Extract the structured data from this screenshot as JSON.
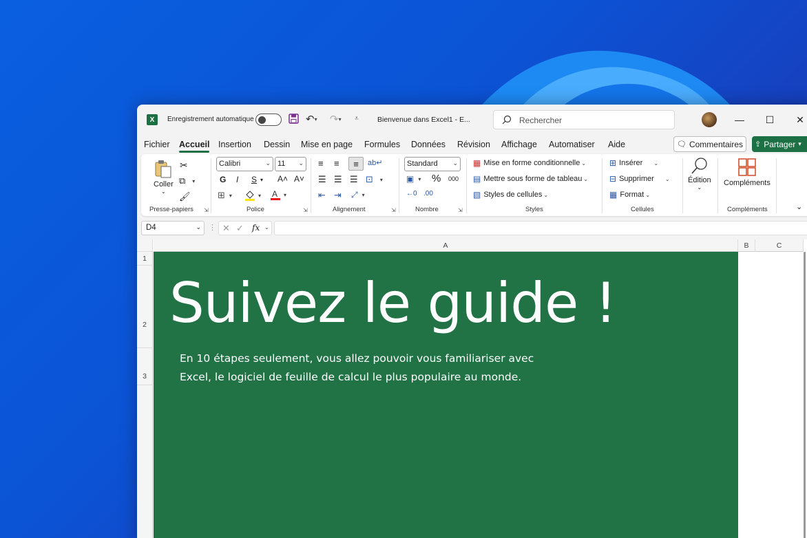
{
  "titlebar": {
    "app_icon": "X",
    "autosave_label": "Enregistrement automatique",
    "doc_title": "Bienvenue dans Excel1  -  E...",
    "search_placeholder": "Rechercher"
  },
  "tabs": [
    "Fichier",
    "Accueil",
    "Insertion",
    "Dessin",
    "Mise en page",
    "Formules",
    "Données",
    "Révision",
    "Affichage",
    "Automatiser",
    "Aide"
  ],
  "active_tab": "Accueil",
  "actions": {
    "comments": "Commentaires",
    "share": "Partager"
  },
  "ribbon": {
    "clipboard": {
      "paste": "Coller",
      "label": "Presse-papiers"
    },
    "font": {
      "name": "Calibri",
      "size": "11",
      "bold": "G",
      "italic": "I",
      "underline": "S",
      "grow": "A˄",
      "shrink": "A˅",
      "label": "Police"
    },
    "alignment": {
      "label": "Alignement"
    },
    "number": {
      "format": "Standard",
      "percent": "%",
      "thousands": "000",
      "label": "Nombre"
    },
    "styles": {
      "conditional": "Mise en forme conditionnelle",
      "table": "Mettre sous forme de tableau",
      "cell_styles": "Styles de cellules",
      "label": "Styles"
    },
    "cells": {
      "insert": "Insérer",
      "delete": "Supprimer",
      "format": "Format",
      "label": "Cellules"
    },
    "editing": {
      "label": "Édition"
    },
    "addins": {
      "button": "Compléments",
      "label": "Compléments"
    }
  },
  "formula_bar": {
    "name_box": "D4",
    "fx": "fx",
    "content": ""
  },
  "grid": {
    "columns": [
      "A",
      "B",
      "C"
    ],
    "rows": [
      "1",
      "2",
      "3"
    ],
    "title": "Suivez le guide !",
    "subtitle_line1": "En 10 étapes seulement, vous allez pouvoir vous familiariser avec",
    "subtitle_line2": "Excel, le logiciel de feuille de calcul le plus populaire au monde."
  },
  "colors": {
    "excel_green": "#217346",
    "accent": "#1d7044",
    "desktop_blue": "#0a5fe0"
  }
}
